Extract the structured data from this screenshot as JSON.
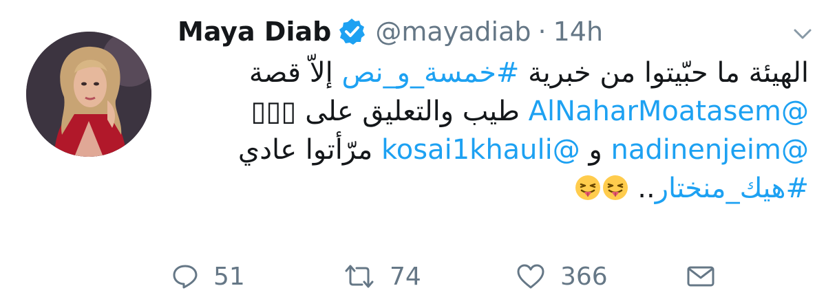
{
  "tweet": {
    "display_name": "Maya Diab",
    "handle": "@mayadiab",
    "separator": "·",
    "time": "14h",
    "verified": true,
    "avatar_alt": "profile photo",
    "lines": [
      [
        {
          "text": "الهيئة ما حبّيتوا من خبرية ",
          "link": false
        },
        {
          "text": "#خمسة_و_نص",
          "link": true
        },
        {
          "text": " إلاّ قصة",
          "link": false
        }
      ],
      [
        {
          "text": "@AlNaharMoatasem",
          "link": true
        },
        {
          "text": " طيب والتعليق على",
          "link": false
        }
      ],
      [
        {
          "text": "@nadinenjeim",
          "link": true
        },
        {
          "text": " و ",
          "link": false
        },
        {
          "text": "@kosai1khauli",
          "link": true
        },
        {
          "text": " مرّأتوا عادي",
          "link": false
        }
      ],
      [
        {
          "text": "#هيك_منختار",
          "link": true
        }
      ]
    ],
    "line2_glyphs": "▯▯▯",
    "line4_dots": "..",
    "emoji_name": "winking-face-with-tongue",
    "emoji_count": 2
  },
  "actions": {
    "reply": {
      "icon": "reply-icon",
      "count": "51"
    },
    "retweet": {
      "icon": "retweet-icon",
      "count": "74"
    },
    "like": {
      "icon": "heart-icon",
      "count": "366"
    },
    "dm": {
      "icon": "mail-icon"
    }
  },
  "colors": {
    "link": "#1da1f2",
    "verified": "#1da1f2",
    "muted": "#657786",
    "text": "#14171a"
  }
}
